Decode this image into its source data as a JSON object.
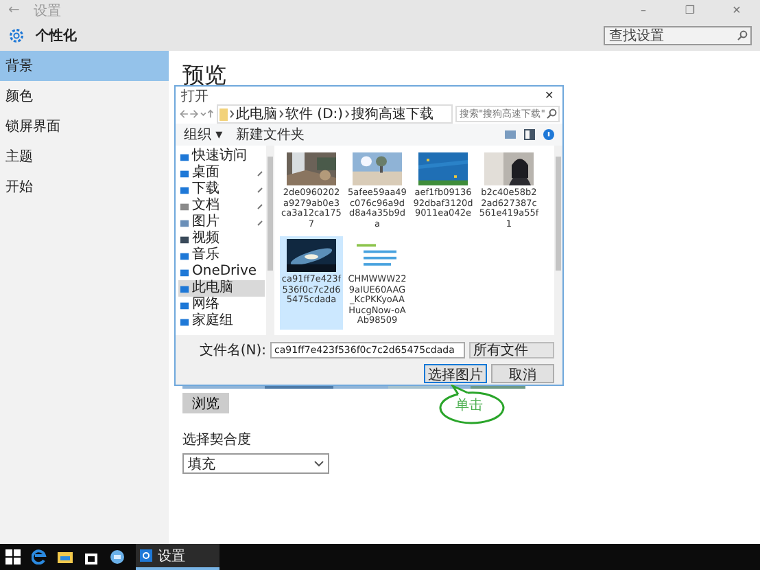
{
  "window": {
    "title": "设置",
    "back": "←",
    "controls": [
      "–",
      "❐",
      "✕"
    ]
  },
  "header": {
    "title": "个性化",
    "search": {
      "placeholder": "查找设置"
    }
  },
  "sidebar": {
    "items": [
      {
        "label": "背景",
        "selected": true
      },
      {
        "label": "颜色",
        "selected": false
      },
      {
        "label": "锁屏界面",
        "selected": false
      },
      {
        "label": "主题",
        "selected": false
      },
      {
        "label": "开始",
        "selected": false
      }
    ]
  },
  "main": {
    "heading": "预览",
    "browse_button": "浏览",
    "fit_label": "选择契合度",
    "fit_dropdown": {
      "value": "填充"
    }
  },
  "dialog": {
    "title": "打开",
    "close": "✕",
    "breadcrumb": [
      "此电脑",
      "软件 (D:)",
      "搜狗高速下载"
    ],
    "search": {
      "placeholder": "搜索\"搜狗高速下载\""
    },
    "toolbar": [
      "组织 ▾",
      "新建文件夹"
    ],
    "nav": [
      {
        "label": "快速访问",
        "pinned": false,
        "selected": false
      },
      {
        "label": "桌面",
        "pinned": true,
        "selected": false
      },
      {
        "label": "下载",
        "pinned": true,
        "selected": false
      },
      {
        "label": "文档",
        "pinned": true,
        "selected": false
      },
      {
        "label": "图片",
        "pinned": true,
        "selected": false
      },
      {
        "label": "视频",
        "pinned": false,
        "selected": false
      },
      {
        "label": "音乐",
        "pinned": false,
        "selected": false
      },
      {
        "label": "OneDrive",
        "pinned": false,
        "selected": false
      },
      {
        "label": "此电脑",
        "pinned": false,
        "selected": true
      },
      {
        "label": "网络",
        "pinned": false,
        "selected": false
      },
      {
        "label": "家庭组",
        "pinned": false,
        "selected": false
      }
    ],
    "files": [
      {
        "name": "2de0960202a9279ab0e3ca3a12ca1757",
        "selected": false
      },
      {
        "name": "5afee59aa49c076c96a9dd8a4a35b9da",
        "selected": false
      },
      {
        "name": "aef1fb0913692dbaf3120d9011ea042e",
        "selected": false
      },
      {
        "name": "b2c40e58b22ad627387c561e419a55f1",
        "selected": false
      },
      {
        "name": "ca91ff7e423f536f0c7c2d65475cdada",
        "selected": true
      },
      {
        "name": "CHMWWW229aIUE60AAG_KcPKKyoAAHucgNow-oAAb98509",
        "selected": false
      }
    ],
    "filename_label": "文件名(N):",
    "filename": "ca91ff7e423f536f0c7c2d65475cdada",
    "filetype": "所有文件",
    "buttons": [
      "选择图片",
      "取消"
    ]
  },
  "callout": {
    "text": "单击"
  },
  "taskbar": {
    "active_app": "设置"
  }
}
